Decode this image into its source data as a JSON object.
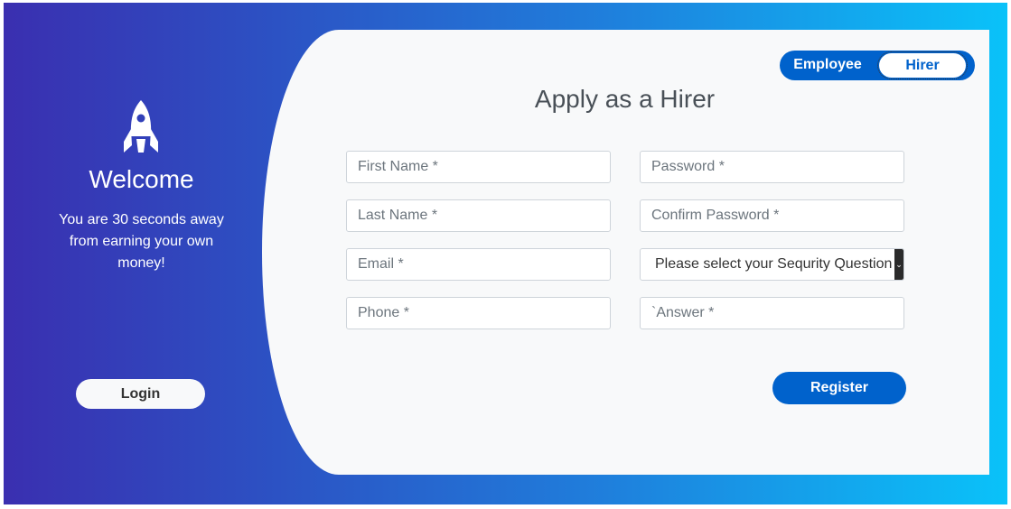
{
  "left_panel": {
    "icon": "rocket-icon",
    "welcome": "Welcome",
    "tagline": "You are 30 seconds away from earning your own money!",
    "login_label": "Login"
  },
  "toggle": {
    "employee_label": "Employee",
    "hirer_label": "Hirer",
    "selected": "Hirer"
  },
  "form": {
    "title": "Apply as a Hirer",
    "first_name_placeholder": "First Name *",
    "last_name_placeholder": "Last Name *",
    "email_placeholder": "Email *",
    "phone_placeholder": "Phone *",
    "password_placeholder": "Password *",
    "confirm_password_placeholder": "Confirm Password *",
    "security_question_selected": "Please select your Sequrity Question",
    "answer_placeholder": "`Answer *",
    "register_label": "Register"
  },
  "colors": {
    "primary": "#0062cc",
    "gradient_start": "#3a2fb0",
    "gradient_end": "#0ac2f9",
    "card_background": "#f8f9fa"
  }
}
